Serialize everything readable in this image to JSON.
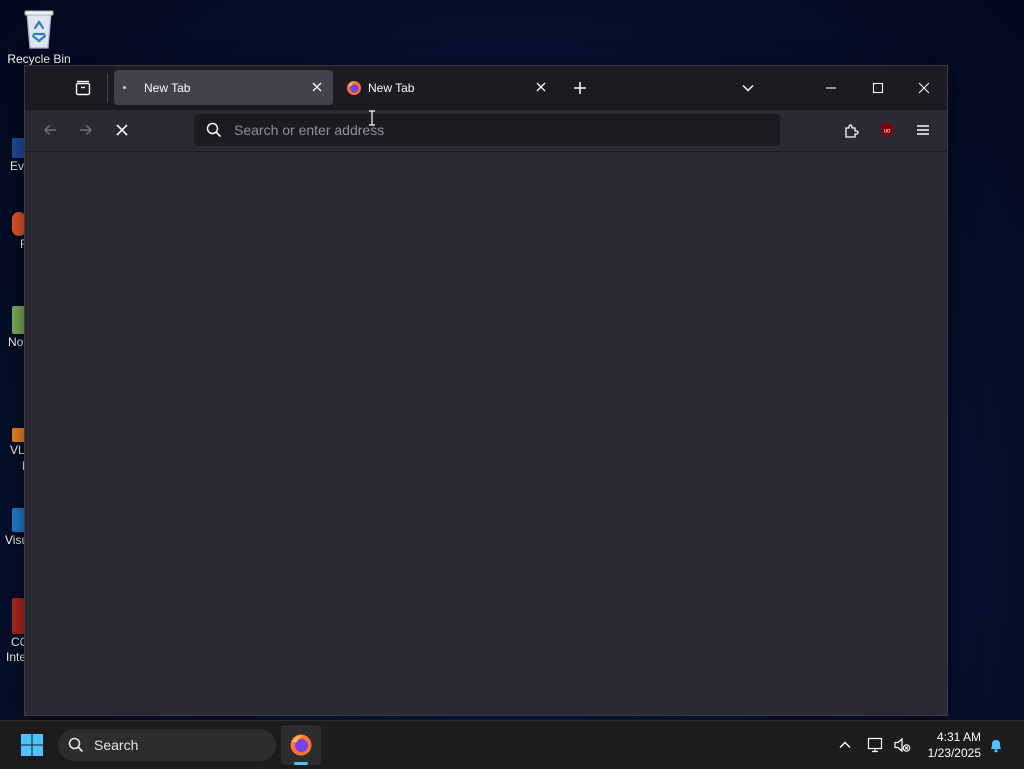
{
  "desktop": {
    "recycle_bin_label": "Recycle Bin",
    "partial_icons": [
      "Eve",
      "F",
      "Not",
      "VLC",
      "P",
      "Visu",
      "CC",
      "Inte"
    ]
  },
  "browser": {
    "tabs": [
      {
        "title": "New Tab",
        "selected": true,
        "loading": true
      },
      {
        "title": "New Tab",
        "selected": false,
        "loading": false
      }
    ],
    "address_placeholder": "Search or enter address",
    "colors": {
      "toolbar": "#2b2a33",
      "tabstrip": "#1c1b22",
      "selected_tab": "#42414d",
      "ublock_red": "#800000"
    }
  },
  "taskbar": {
    "search_label": "Search",
    "time": "4:31 AM",
    "date": "1/23/2025"
  }
}
